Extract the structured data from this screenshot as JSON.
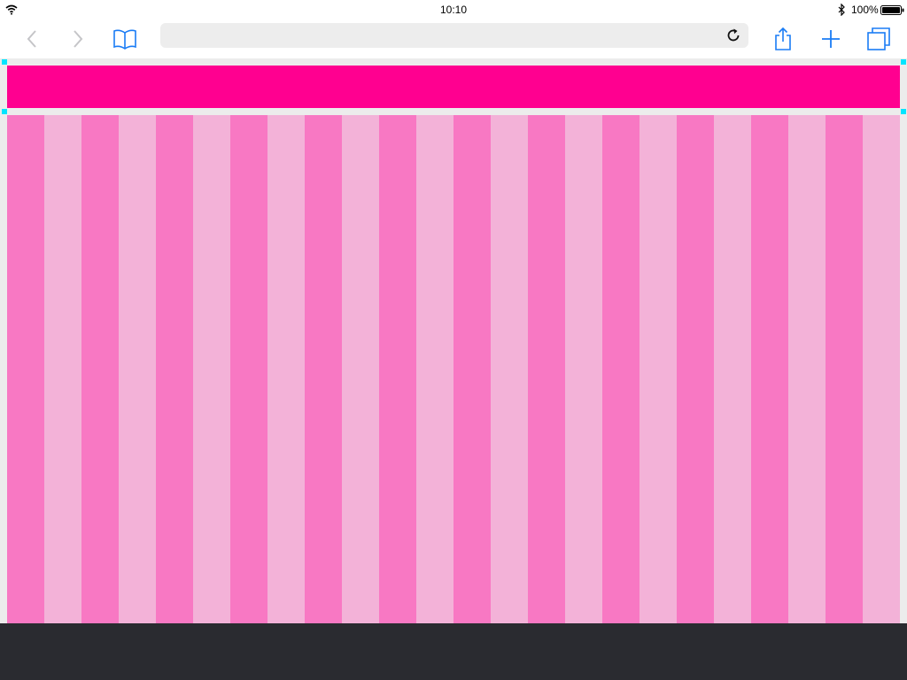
{
  "status_bar": {
    "time": "10:10",
    "battery_percent": "100%",
    "icons": [
      "wifi-icon",
      "bluetooth-icon",
      "battery-icon"
    ]
  },
  "toolbar": {
    "address": {
      "value": "",
      "placeholder": ""
    },
    "icons": [
      "chevron-left-icon",
      "chevron-right-icon",
      "book-icon",
      "reload-icon",
      "share-icon",
      "plus-icon",
      "tabs-icon"
    ]
  },
  "page": {
    "colors": {
      "header_band": "#ff0090",
      "column_dark": "#f878c3",
      "column_light": "#f3b2d8",
      "handle": "#00e5ff",
      "background": "#ececec",
      "bottom_bar": "#2a2b30"
    },
    "column_count": 24
  }
}
